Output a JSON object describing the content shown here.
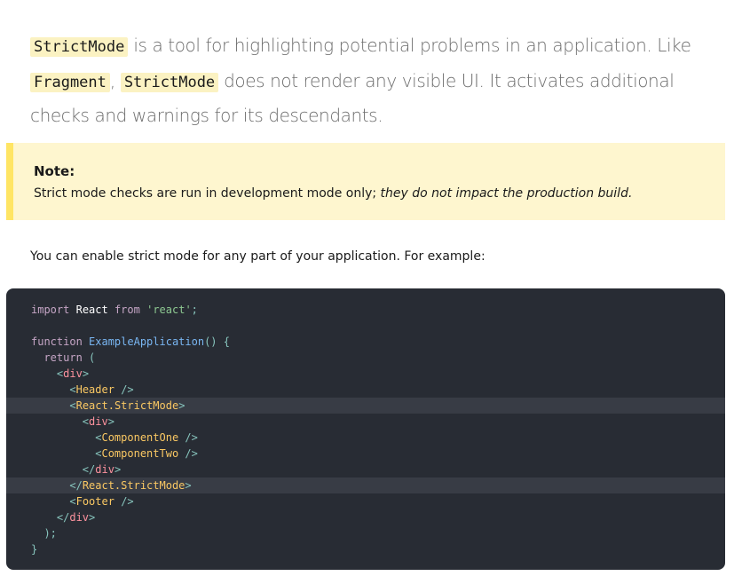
{
  "intro": {
    "code1": "StrictMode",
    "text1": " is a tool for highlighting potential problems in an application. Like ",
    "code2": "Fragment",
    "text2": ", ",
    "code3": "StrictMode",
    "text3": " does not render any visible UI. It activates additional checks and warnings for its descendants."
  },
  "note": {
    "title": "Note:",
    "text": "Strict mode checks are run in development mode only; ",
    "emphasis": "they do not impact the production build."
  },
  "enable_text": "You can enable strict mode for any part of your application. For example:",
  "code": {
    "lines": [
      {
        "indent": "",
        "tokens": [
          [
            "kw",
            "import"
          ],
          [
            "plain",
            " "
          ],
          [
            "name",
            "React"
          ],
          [
            "plain",
            " "
          ],
          [
            "kw",
            "from"
          ],
          [
            "plain",
            " "
          ],
          [
            "str",
            "'react'"
          ],
          [
            "punct",
            ";"
          ]
        ]
      },
      {
        "indent": "",
        "tokens": []
      },
      {
        "indent": "",
        "tokens": [
          [
            "kw",
            "function"
          ],
          [
            "plain",
            " "
          ],
          [
            "fn",
            "ExampleApplication"
          ],
          [
            "punct",
            "()"
          ],
          [
            "plain",
            " "
          ],
          [
            "punct",
            "{"
          ]
        ]
      },
      {
        "indent": "  ",
        "tokens": [
          [
            "kw",
            "return"
          ],
          [
            "plain",
            " "
          ],
          [
            "punct",
            "("
          ]
        ]
      },
      {
        "indent": "    ",
        "tokens": [
          [
            "punct",
            "<"
          ],
          [
            "tag",
            "div"
          ],
          [
            "punct",
            ">"
          ]
        ]
      },
      {
        "indent": "      ",
        "tokens": [
          [
            "punct",
            "<"
          ],
          [
            "comp",
            "Header"
          ],
          [
            "plain",
            " "
          ],
          [
            "punct",
            "/>"
          ]
        ]
      },
      {
        "indent": "      ",
        "highlight": true,
        "tokens": [
          [
            "punct",
            "<"
          ],
          [
            "comp",
            "React.StrictMode"
          ],
          [
            "punct",
            ">"
          ]
        ]
      },
      {
        "indent": "        ",
        "tokens": [
          [
            "punct",
            "<"
          ],
          [
            "tag",
            "div"
          ],
          [
            "punct",
            ">"
          ]
        ]
      },
      {
        "indent": "          ",
        "tokens": [
          [
            "punct",
            "<"
          ],
          [
            "comp",
            "ComponentOne"
          ],
          [
            "plain",
            " "
          ],
          [
            "punct",
            "/>"
          ]
        ]
      },
      {
        "indent": "          ",
        "tokens": [
          [
            "punct",
            "<"
          ],
          [
            "comp",
            "ComponentTwo"
          ],
          [
            "plain",
            " "
          ],
          [
            "punct",
            "/>"
          ]
        ]
      },
      {
        "indent": "        ",
        "tokens": [
          [
            "punct",
            "</"
          ],
          [
            "tag",
            "div"
          ],
          [
            "punct",
            ">"
          ]
        ]
      },
      {
        "indent": "      ",
        "highlight": true,
        "tokens": [
          [
            "punct",
            "</"
          ],
          [
            "comp",
            "React.StrictMode"
          ],
          [
            "punct",
            ">"
          ]
        ]
      },
      {
        "indent": "      ",
        "tokens": [
          [
            "punct",
            "<"
          ],
          [
            "comp",
            "Footer"
          ],
          [
            "plain",
            " "
          ],
          [
            "punct",
            "/>"
          ]
        ]
      },
      {
        "indent": "    ",
        "tokens": [
          [
            "punct",
            "</"
          ],
          [
            "tag",
            "div"
          ],
          [
            "punct",
            ">"
          ]
        ]
      },
      {
        "indent": "  ",
        "tokens": [
          [
            "punct",
            ");"
          ]
        ]
      },
      {
        "indent": "",
        "tokens": [
          [
            "punct",
            "}"
          ]
        ]
      }
    ]
  },
  "colors": {
    "code_bg": "#282c34",
    "note_bg": "#fef6cf",
    "note_border": "#ffe564",
    "inline_code_bg": "#fbf2c2"
  }
}
